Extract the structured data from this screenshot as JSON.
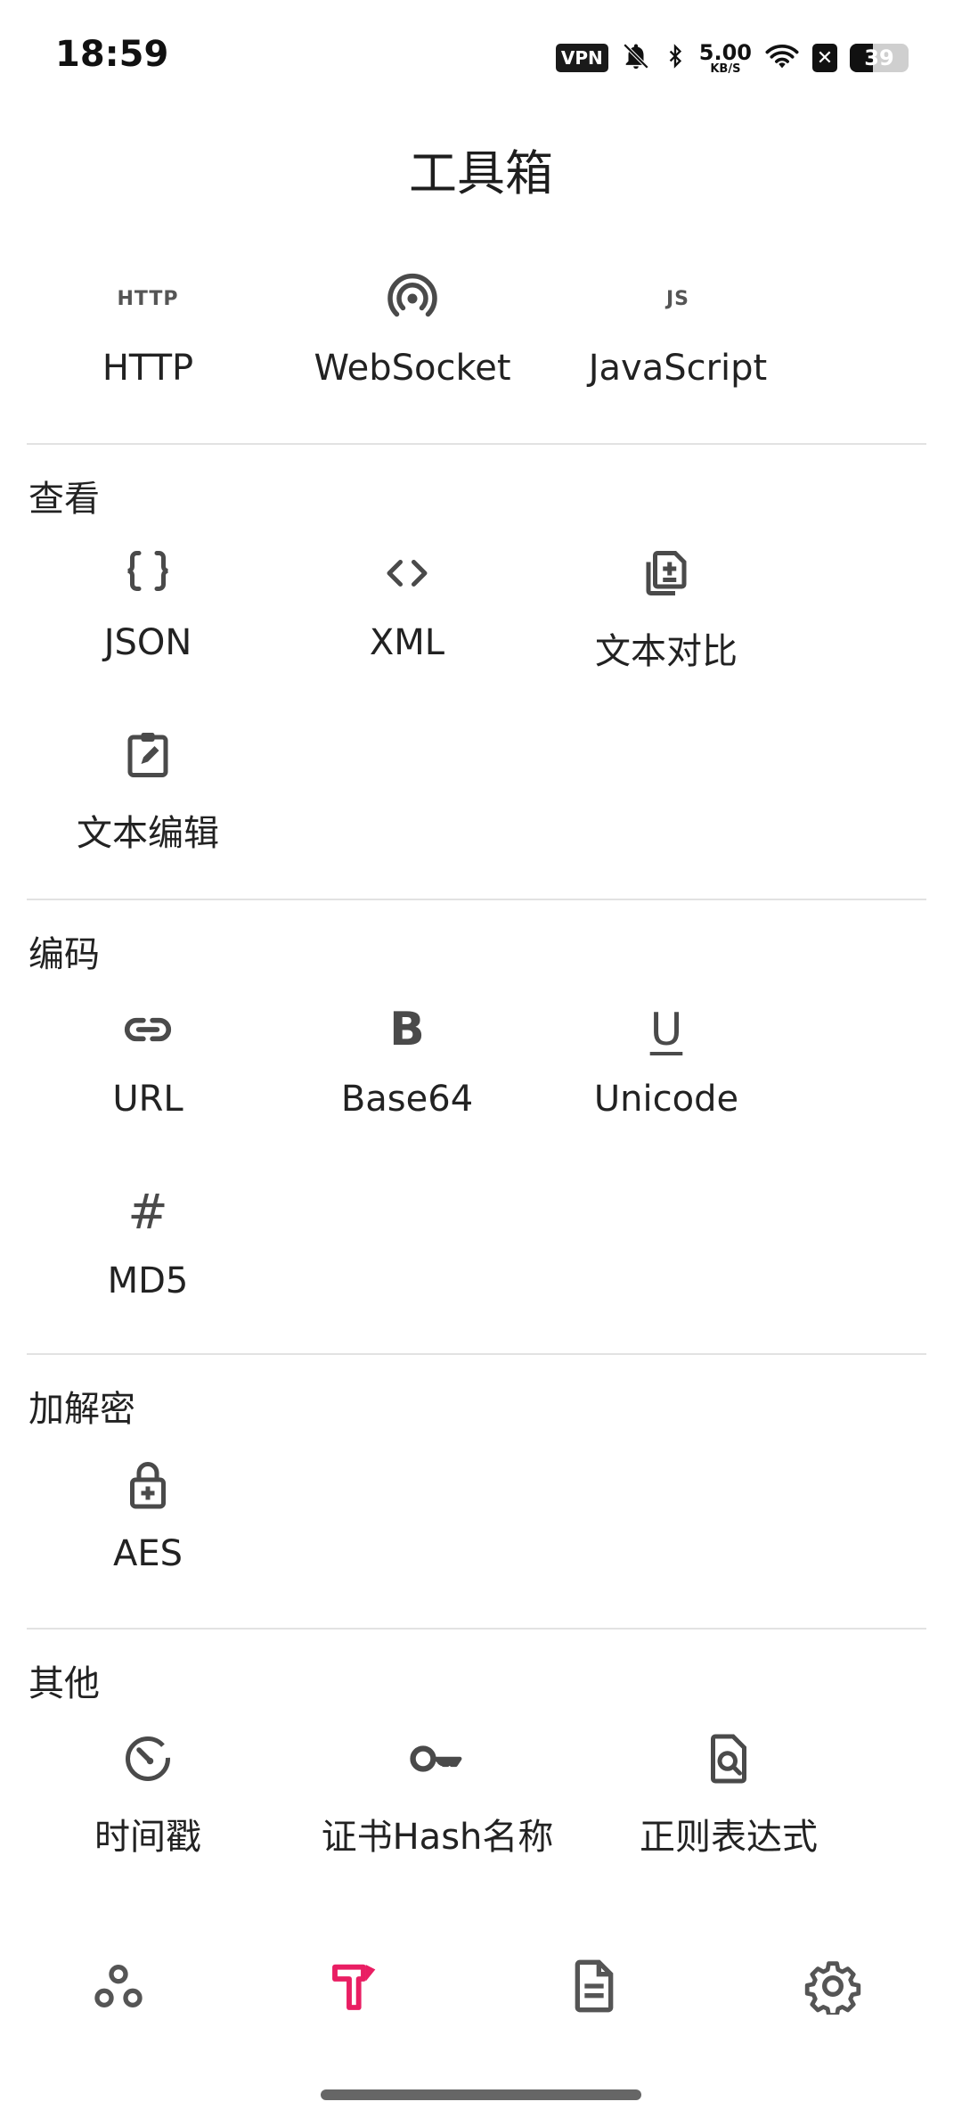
{
  "status_bar": {
    "time": "18:59",
    "vpn": "VPN",
    "net_speed_value": "5.00",
    "net_speed_unit": "KB/S",
    "battery": "39",
    "battery_level": 0.39
  },
  "header": {
    "title": "工具箱"
  },
  "top_tools": [
    {
      "label": "HTTP",
      "icon": "http-text-icon",
      "icon_text": "HTTP"
    },
    {
      "label": "WebSocket",
      "icon": "websocket-icon"
    },
    {
      "label": "JavaScript",
      "icon": "js-text-icon",
      "icon_text": "JS"
    }
  ],
  "sections": {
    "view": {
      "title": "查看",
      "items": [
        {
          "label": "JSON",
          "icon": "braces-icon"
        },
        {
          "label": "XML",
          "icon": "code-brackets-icon"
        },
        {
          "label": "文本对比",
          "icon": "copy-compare-icon"
        },
        {
          "label": "文本编辑",
          "icon": "clipboard-edit-icon"
        }
      ]
    },
    "encoding": {
      "title": "编码",
      "items": [
        {
          "label": "URL",
          "icon": "link-icon"
        },
        {
          "label": "Base64",
          "icon": "bold-b-icon",
          "icon_text": "B"
        },
        {
          "label": "Unicode",
          "icon": "underline-u-icon",
          "icon_text": "U"
        },
        {
          "label": "MD5",
          "icon": "hash-icon",
          "icon_text": "#"
        }
      ]
    },
    "crypto": {
      "title": "加解密",
      "items": [
        {
          "label": "AES",
          "icon": "lock-plus-icon"
        }
      ]
    },
    "other": {
      "title": "其他",
      "items": [
        {
          "label": "时间戳",
          "icon": "timer-icon"
        },
        {
          "label": "证书Hash名称",
          "icon": "key-icon"
        },
        {
          "label": "正则表达式",
          "icon": "file-search-icon"
        }
      ]
    }
  },
  "bottom_nav": {
    "items": [
      "network-nodes-icon",
      "toolbox-hammer-icon",
      "document-icon",
      "settings-gear-icon"
    ],
    "active_index": 1,
    "accent_color": "#e91e63",
    "inactive_color": "#555555"
  }
}
